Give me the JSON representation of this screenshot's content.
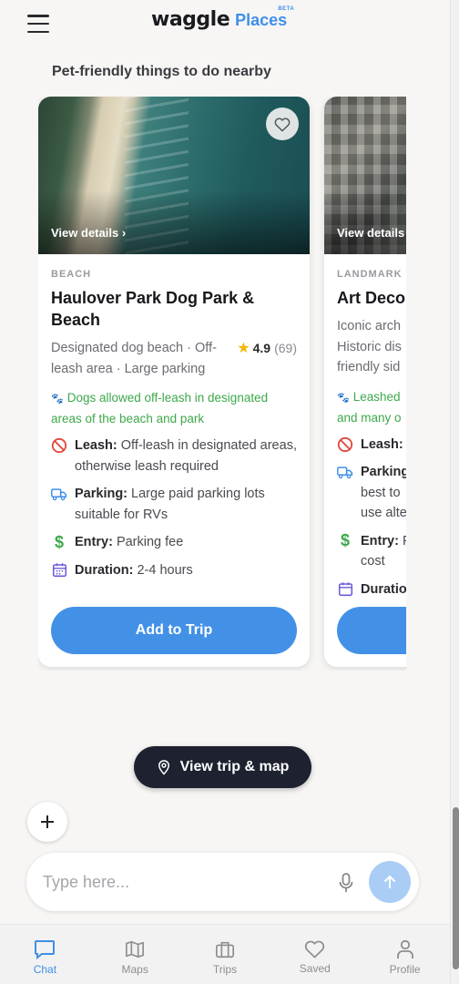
{
  "header": {
    "logo_text": "waggle",
    "places_text": "Places",
    "beta_text": "BETA",
    "menu_icon": "hamburger-icon"
  },
  "section_title": "Pet-friendly things to do nearby",
  "cards": [
    {
      "view_details": "View details",
      "category": "BEACH",
      "title": "Haulover Park Dog Park & Beach",
      "description": "Designated dog beach · Off-leash area · Large parking",
      "rating": "4.9",
      "rating_count": "(69)",
      "dogs_note": "Dogs allowed off-leash in designated areas of the beach and park",
      "leash_label": "Leash:",
      "leash_value": "Off-leash in designated areas, otherwise leash required",
      "parking_label": "Parking:",
      "parking_value": "Large paid parking lots suitable for RVs",
      "entry_label": "Entry:",
      "entry_value": "Parking fee",
      "duration_label": "Duration:",
      "duration_value": "2-4 hours",
      "add_button": "Add to Trip"
    },
    {
      "view_details": "View details",
      "category": "LANDMARK",
      "title": "Art Deco",
      "description": "Iconic arch Historic dis friendly sid",
      "dogs_note": "Leashed and many o",
      "leash_label": "Leash:",
      "parking_label": "Parking",
      "parking_value": "best to use alte",
      "entry_label": "Entry:",
      "entry_value": "F cost",
      "duration_label": "Duratio"
    }
  ],
  "trip_map_button": "View trip & map",
  "chat": {
    "placeholder": "Type here..."
  },
  "nav": [
    {
      "label": "Chat",
      "icon": "chat-icon",
      "active": true
    },
    {
      "label": "Maps",
      "icon": "map-icon",
      "active": false
    },
    {
      "label": "Trips",
      "icon": "suitcase-icon",
      "active": false
    },
    {
      "label": "Saved",
      "icon": "heart-icon",
      "active": false
    },
    {
      "label": "Profile",
      "icon": "person-icon",
      "active": false
    }
  ],
  "colors": {
    "accent": "#3f8fe8",
    "add_button": "#4391e7",
    "dark_button": "#1d2130",
    "green_note": "#3da84a",
    "star": "#f5b400"
  }
}
